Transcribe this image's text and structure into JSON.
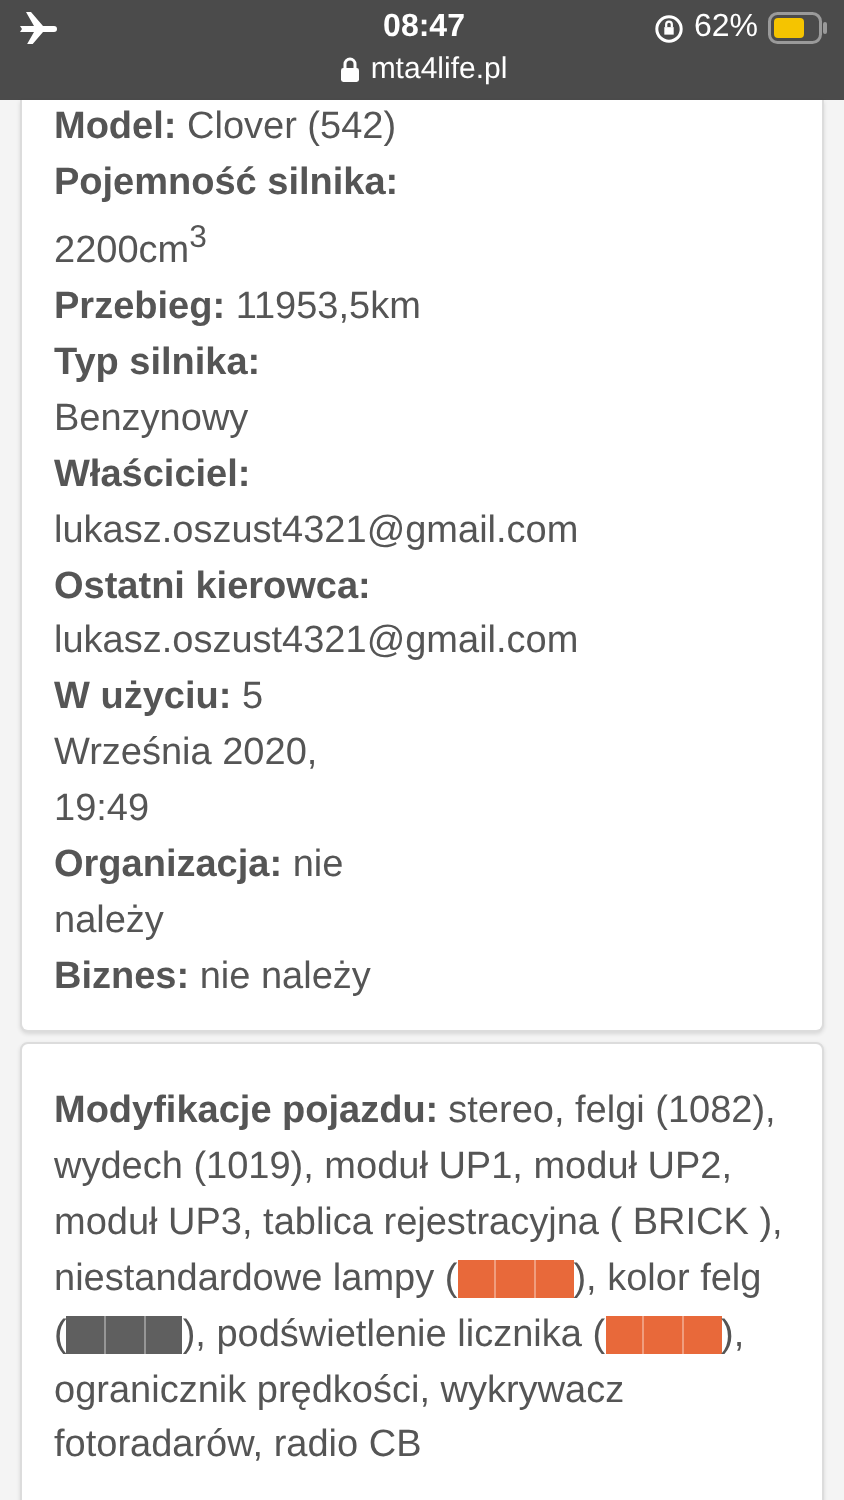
{
  "status_bar": {
    "time": "08:47",
    "url": "mta4life.pl",
    "battery": "62%"
  },
  "details": [
    {
      "label": "Model:",
      "kind": "inline",
      "lines": [
        "Clover (542)"
      ]
    },
    {
      "label": "Pojemność silnika:",
      "kind": "below",
      "lines": [
        "2200cm$^{3}$"
      ]
    },
    {
      "label": "Przebieg:",
      "kind": "inline",
      "lines": [
        "11953,5km"
      ]
    },
    {
      "label": "Typ silnika:",
      "kind": "below",
      "lines": [
        "Benzynowy"
      ]
    },
    {
      "label": "Właściciel:",
      "kind": "below",
      "lines": [
        "lukasz.oszust4321@gmail.com"
      ]
    },
    {
      "label": "Ostatni kierowca:",
      "kind": "below",
      "lines": [
        "lukasz.oszust4321@gmail.com"
      ]
    },
    {
      "label": "W użyciu:",
      "kind": "inline",
      "lines": [
        "5",
        "Września 2020,",
        "19:49"
      ]
    },
    {
      "label": "Organizacja:",
      "kind": "inline",
      "lines": [
        "nie",
        "należy"
      ]
    },
    {
      "label": "Biznes:",
      "kind": "inline",
      "lines": [
        "nie należy"
      ]
    }
  ],
  "modifications": {
    "lines": [
      [
        {
          "kind": "label",
          "text": "Modyfikacje pojazdu:"
        },
        {
          "kind": "text",
          "text": "stereo, felgi (1082),"
        }
      ],
      [
        {
          "kind": "text",
          "text": "wydech (1019), moduł UP1, moduł UP2,"
        }
      ],
      [
        {
          "kind": "text",
          "text": "moduł UP3, tablica rejestracyjna ( BRICK ),"
        }
      ],
      [
        {
          "kind": "text",
          "text": "niestandardowe lampy ("
        },
        {
          "kind": "swatch",
          "color": "#e8693a"
        },
        {
          "kind": "text",
          "text": "), kolor felg"
        }
      ],
      [
        {
          "kind": "text",
          "text": "("
        },
        {
          "kind": "swatch",
          "color": "#5f5f5f"
        },
        {
          "kind": "text",
          "text": "), podświetlenie licznika ("
        },
        {
          "kind": "swatch",
          "color": "#e8693a"
        },
        {
          "kind": "text",
          "text": "),"
        }
      ],
      [
        {
          "kind": "text",
          "text": "ogranicznik prędkości, wykrywacz"
        }
      ],
      [
        {
          "kind": "text",
          "text": "fotoradarów, radio CB"
        }
      ]
    ]
  }
}
